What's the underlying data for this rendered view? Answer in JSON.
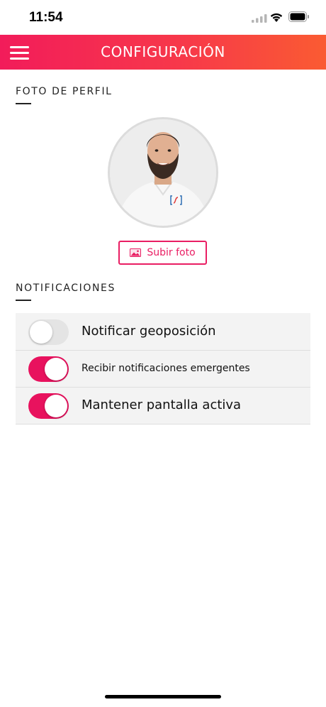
{
  "status_bar": {
    "time": "11:54"
  },
  "header": {
    "title": "CONFIGURACIÓN",
    "gradient_start": "#f21c5a",
    "gradient_end": "#fa5b32"
  },
  "profile_section": {
    "title": "FOTO DE PERFIL",
    "upload_label": "Subir foto",
    "upload_icon": "image-icon"
  },
  "notifications_section": {
    "title": "NOTIFICACIONES",
    "items": [
      {
        "label": "Notificar geoposición",
        "enabled": false
      },
      {
        "label": "Recibir notificaciones emergentes",
        "enabled": true
      },
      {
        "label": "Mantener pantalla activa",
        "enabled": true
      }
    ]
  },
  "colors": {
    "accent": "#e8125e",
    "toggle_off": "#e4e4e4",
    "row_background": "#f3f3f3"
  }
}
